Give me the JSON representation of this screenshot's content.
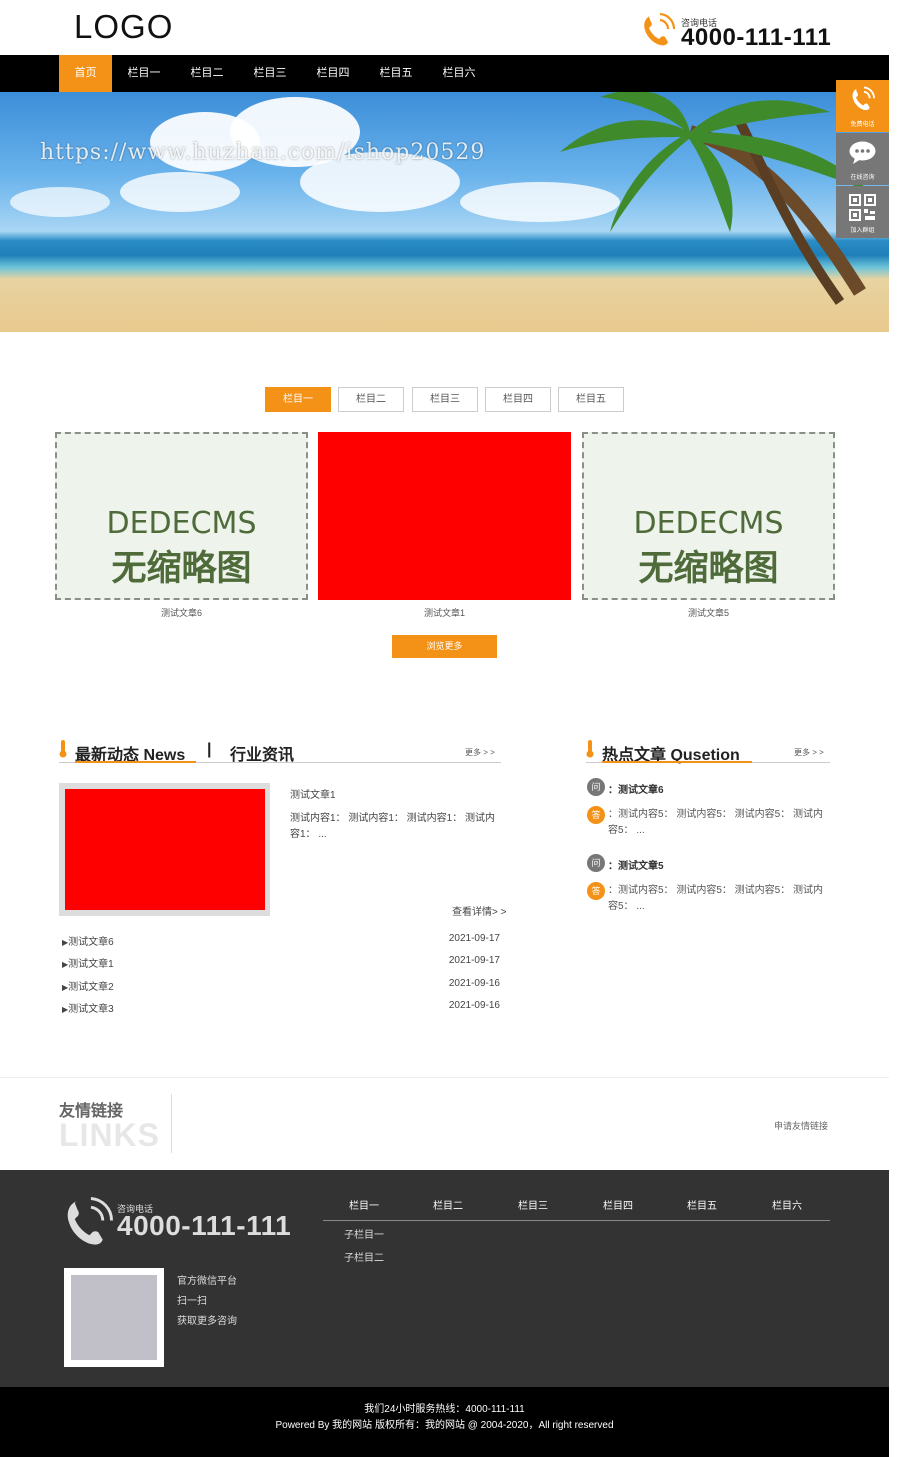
{
  "header": {
    "logo": "LOGO",
    "phone_label": "咨询电话",
    "phone_number": "4000-111-111"
  },
  "nav": {
    "items": [
      "首页",
      "栏目一",
      "栏目二",
      "栏目三",
      "栏目四",
      "栏目五",
      "栏目六"
    ],
    "active_index": 0
  },
  "banner": {
    "watermark": "https://www.huzhan.com/ishop20529"
  },
  "side_tools": {
    "call_label": "免费电话",
    "chat_label": "在线咨询",
    "qr_label": "加入群组"
  },
  "product_tabs": {
    "items": [
      "栏目一",
      "栏目二",
      "栏目三",
      "栏目四",
      "栏目五"
    ],
    "active_index": 0
  },
  "products": [
    {
      "caption": "测试文章6",
      "placeholder_line1": "DEDECMS",
      "placeholder_line2": "无缩略图"
    },
    {
      "caption": "测试文章1"
    },
    {
      "caption": "测试文章5",
      "placeholder_line1": "DEDECMS",
      "placeholder_line2": "无缩略图"
    }
  ],
  "browse_more": "浏览更多",
  "news": {
    "title": "最新动态 News",
    "divider": "|",
    "title2": "行业资讯",
    "more": "更多 > >",
    "featured_title": "测试文章1",
    "featured_desc": "测试内容1： 测试内容1： 测试内容1： 测试内容1： ...",
    "detail_link": "查看详情> >",
    "list": [
      {
        "title": "测试文章6",
        "date": "2021-09-17"
      },
      {
        "title": "测试文章1",
        "date": "2021-09-17"
      },
      {
        "title": "测试文章2",
        "date": "2021-09-16"
      },
      {
        "title": "测试文章3",
        "date": "2021-09-16"
      }
    ]
  },
  "hot": {
    "title": "热点文章 Qusetion",
    "more": "更多 > >",
    "q_badge": "问",
    "a_badge": "答",
    "items": [
      {
        "q": "：测试文章6",
        "a": "：测试内容5： 测试内容5： 测试内容5： 测试内容5： ..."
      },
      {
        "q": "：测试文章5",
        "a": "：测试内容5： 测试内容5： 测试内容5： 测试内容5： ..."
      }
    ]
  },
  "links": {
    "title": "友情链接",
    "en": "LINKS",
    "apply": "申请友情链接"
  },
  "footer": {
    "phone_label": "咨询电话",
    "phone_number": "4000-111-111",
    "wechat_lines": [
      "官方微信平台",
      "扫一扫",
      "获取更多咨询"
    ],
    "nav": [
      "栏目一",
      "栏目二",
      "栏目三",
      "栏目四",
      "栏目五",
      "栏目六"
    ],
    "sub_items": [
      "子栏目一",
      "子栏目二"
    ],
    "hotline": "我们24小时服务热线：4000-111-111",
    "copyright": "Powered By 我的网站 版权所有：我的网站 @ 2004-2020，All right reserved"
  },
  "colors": {
    "accent": "#f39217",
    "nav_bg": "#000000",
    "footer_bg": "#333333",
    "placeholder_red": "#ff0000"
  }
}
